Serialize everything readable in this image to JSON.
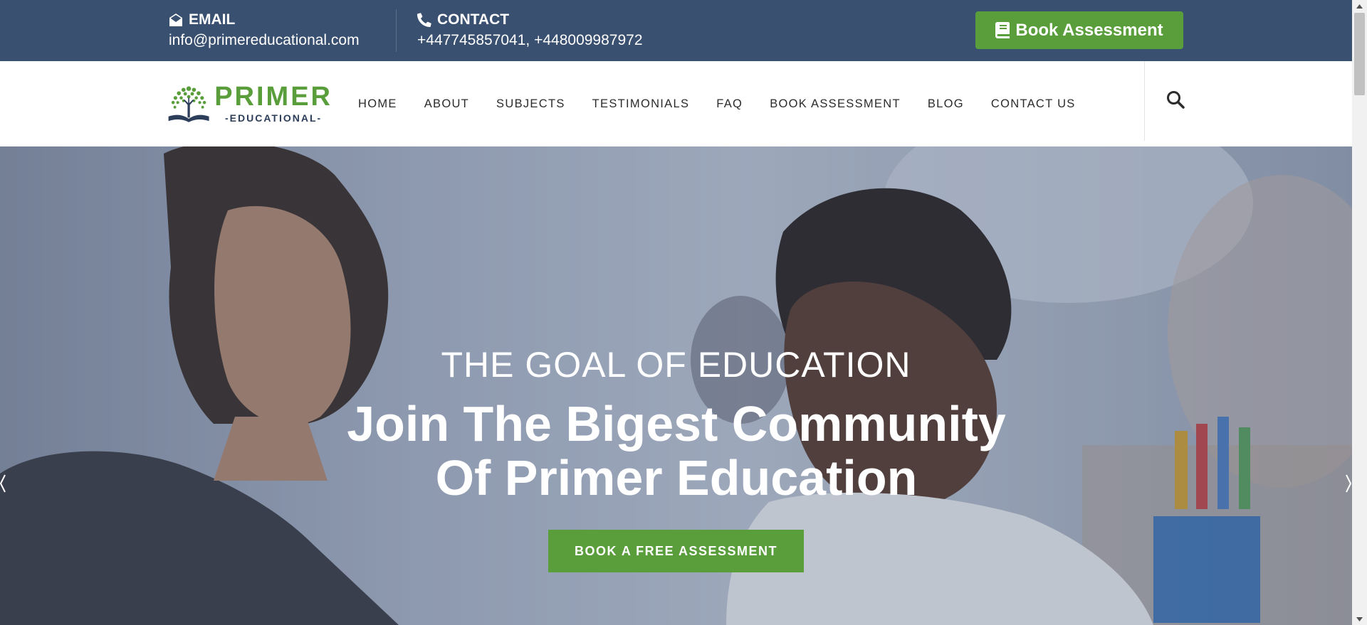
{
  "topbar": {
    "email_heading": "EMAIL",
    "email_value": "info@primereducational.com",
    "contact_heading": "CONTACT",
    "contact_value": "+447745857041, +448009987972",
    "book_button_label": "Book Assessment"
  },
  "logo": {
    "primary": "PRIMER",
    "secondary": "-EDUCATIONAL-"
  },
  "nav": {
    "items": [
      {
        "label": "HOME"
      },
      {
        "label": "ABOUT"
      },
      {
        "label": "SUBJECTS"
      },
      {
        "label": "TESTIMONIALS"
      },
      {
        "label": "FAQ"
      },
      {
        "label": "BOOK ASSESSMENT"
      },
      {
        "label": "BLOG"
      },
      {
        "label": "CONTACT US"
      }
    ],
    "search_icon": "search-icon"
  },
  "hero": {
    "subtitle": "THE GOAL OF EDUCATION",
    "title": "Join The Bigest Community Of Primer Education",
    "cta_label": "BOOK A FREE ASSESSMENT"
  },
  "icons": {
    "email": "envelope-open-icon",
    "contact": "phone-icon",
    "book": "book-icon",
    "search": "search-icon"
  },
  "colors": {
    "topbar": "#3a5070",
    "accent_green": "#5a9e3c",
    "nav_text": "#2b2b2b",
    "logo_navy": "#2c3e5a"
  }
}
